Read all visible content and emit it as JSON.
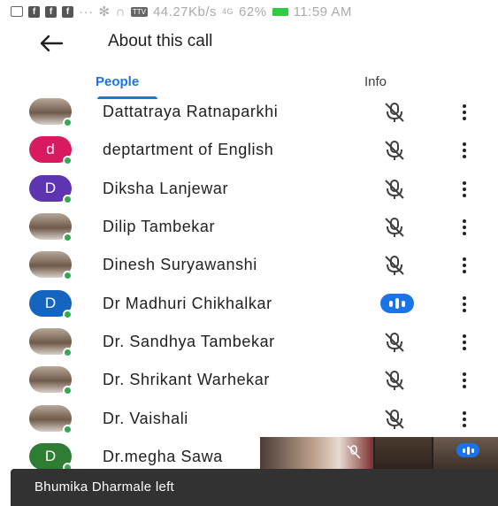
{
  "status_bar": {
    "text": "44.27Kb/s",
    "network": "4G",
    "battery": "62%",
    "time": "11:59 AM"
  },
  "header": {
    "title": "About this call",
    "back_icon": "arrow-back-icon"
  },
  "tabs": [
    {
      "label": "People",
      "active": true
    },
    {
      "label": "Info",
      "active": false
    }
  ],
  "participants": [
    {
      "name": "Dattatraya Ratnaparkhi",
      "avatar": "photo",
      "mic": "muted"
    },
    {
      "name": "deptartment of English",
      "avatar": "letter",
      "initial": "d",
      "color": "#d81b60",
      "mic": "muted"
    },
    {
      "name": "Diksha Lanjewar",
      "avatar": "letter",
      "initial": "D",
      "color": "#5e35b1",
      "mic": "muted"
    },
    {
      "name": "Dilip Tambekar",
      "avatar": "photo",
      "mic": "muted"
    },
    {
      "name": "Dinesh Suryawanshi",
      "avatar": "photo",
      "mic": "muted"
    },
    {
      "name": "Dr Madhuri Chikhalkar",
      "avatar": "letter",
      "initial": "D",
      "color": "#1565c0",
      "mic": "speaking"
    },
    {
      "name": "Dr. Sandhya Tambekar",
      "avatar": "photo",
      "mic": "muted"
    },
    {
      "name": "Dr. Shrikant Warhekar",
      "avatar": "photo",
      "mic": "muted"
    },
    {
      "name": "Dr. Vaishali",
      "avatar": "photo",
      "mic": "muted"
    },
    {
      "name": "Dr.megha Sawa",
      "avatar": "letter",
      "initial": "D",
      "color": "#2e7d32",
      "mic": "muted"
    }
  ],
  "snackbar": {
    "text": "Bhumika Dharmale left"
  },
  "colors": {
    "accent": "#1a73e8",
    "online": "#34a853",
    "snackbar": "#323232"
  }
}
